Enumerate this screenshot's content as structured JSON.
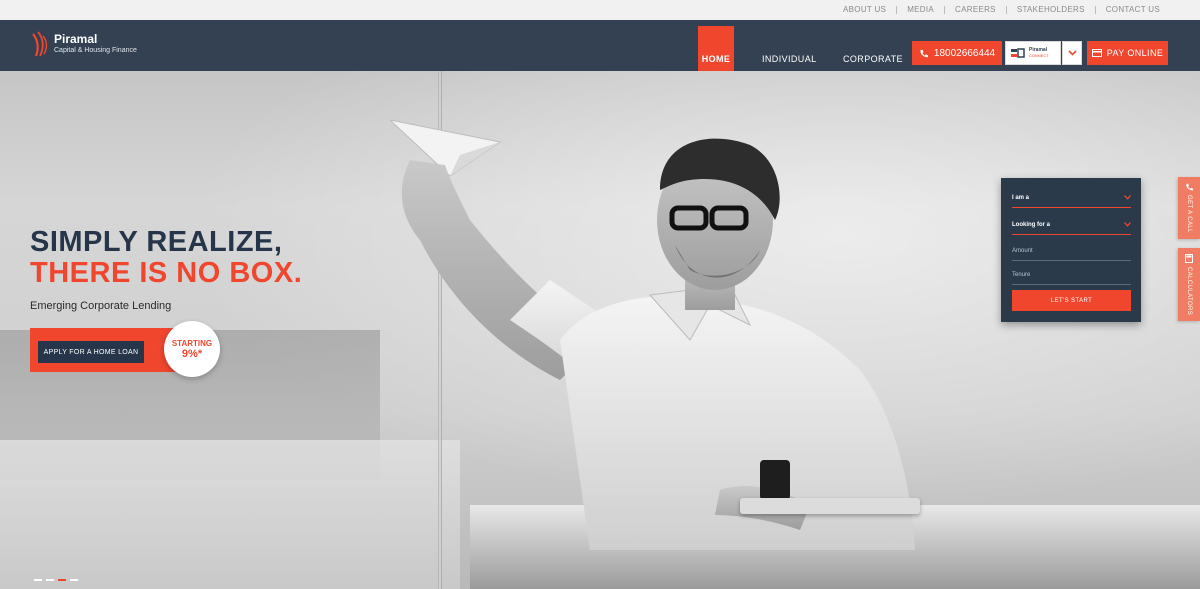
{
  "top_links": [
    "ABOUT US",
    "MEDIA",
    "CAREERS",
    "STAKEHOLDERS",
    "CONTACT US"
  ],
  "brand": {
    "name": "Piramal",
    "tagline": "Capital & Housing Finance"
  },
  "nav": {
    "home": "HOME",
    "individual": "INDIVIDUAL",
    "corporate": "CORPORATE"
  },
  "phone": "18002666444",
  "connect": {
    "line1": "Piramal",
    "line2": "CONNECT"
  },
  "pay_label": "PAY ONLINE",
  "hero": {
    "line1": "SIMPLY REALIZE,",
    "line2": "THERE IS NO BOX.",
    "subtitle": "Emerging Corporate Lending",
    "cta": "APPLY FOR A HOME LOAN",
    "badge_line1": "STARTING",
    "badge_line2": "9%*"
  },
  "form": {
    "iam": "I am a",
    "looking": "Looking for a",
    "amount": "Amount",
    "tenure": "Tenure",
    "submit": "LET'S START"
  },
  "side_tabs": {
    "call": "GET A CALL",
    "calculators": "CALCULATORS"
  },
  "slider": {
    "count": 4,
    "active_index": 2
  },
  "colors": {
    "accent": "#f0462e",
    "navy": "#334152",
    "form_bg": "#2b3a4b"
  }
}
